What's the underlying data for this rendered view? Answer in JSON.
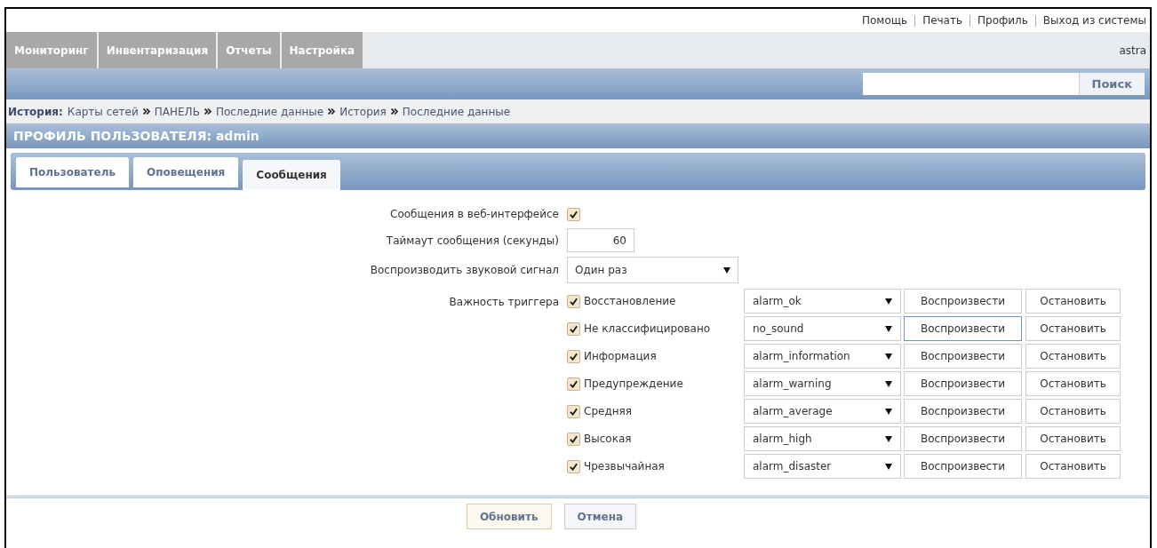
{
  "top_links": [
    "Помощь",
    "Печать",
    "Профиль",
    "Выход из системы"
  ],
  "nav": {
    "items": [
      "Мониторинг",
      "Инвентаризация",
      "Отчеты",
      "Настройка"
    ],
    "user": "astra"
  },
  "search": {
    "button": "Поиск"
  },
  "breadcrumb": {
    "label": "История:",
    "items": [
      "Карты сетей",
      "ПАНЕЛЬ",
      "Последние данные",
      "История",
      "Последние данные"
    ]
  },
  "page_title": "ПРОФИЛЬ ПОЛЬЗОВАТЕЛЯ: admin",
  "tabs": [
    {
      "label": "Пользователь",
      "selected": false
    },
    {
      "label": "Оповещения",
      "selected": false
    },
    {
      "label": "Сообщения",
      "selected": true
    }
  ],
  "form": {
    "web_messages": {
      "label": "Сообщения в веб-интерфейсе",
      "checked": true
    },
    "timeout": {
      "label": "Таймаут сообщения (секунды)",
      "value": "60"
    },
    "play_sound": {
      "label": "Воспроизводить звуковой сигнал",
      "value": "Один раз"
    },
    "severity_label": "Важность триггера",
    "severities": [
      {
        "name": "Восстановление",
        "checked": true,
        "sound": "alarm_ok",
        "play": "Воспроизвести",
        "stop": "Остановить",
        "focused": false
      },
      {
        "name": "Не классифицировано",
        "checked": true,
        "sound": "no_sound",
        "play": "Воспроизвести",
        "stop": "Остановить",
        "focused": true
      },
      {
        "name": "Информация",
        "checked": true,
        "sound": "alarm_information",
        "play": "Воспроизвести",
        "stop": "Остановить",
        "focused": false
      },
      {
        "name": "Предупреждение",
        "checked": true,
        "sound": "alarm_warning",
        "play": "Воспроизвести",
        "stop": "Остановить",
        "focused": false
      },
      {
        "name": "Средняя",
        "checked": true,
        "sound": "alarm_average",
        "play": "Воспроизвести",
        "stop": "Остановить",
        "focused": false
      },
      {
        "name": "Высокая",
        "checked": true,
        "sound": "alarm_high",
        "play": "Воспроизвести",
        "stop": "Остановить",
        "focused": false
      },
      {
        "name": "Чрезвычайная",
        "checked": true,
        "sound": "alarm_disaster",
        "play": "Воспроизвести",
        "stop": "Остановить",
        "focused": false
      }
    ]
  },
  "buttons": [
    "Обновить",
    "Отмена"
  ]
}
